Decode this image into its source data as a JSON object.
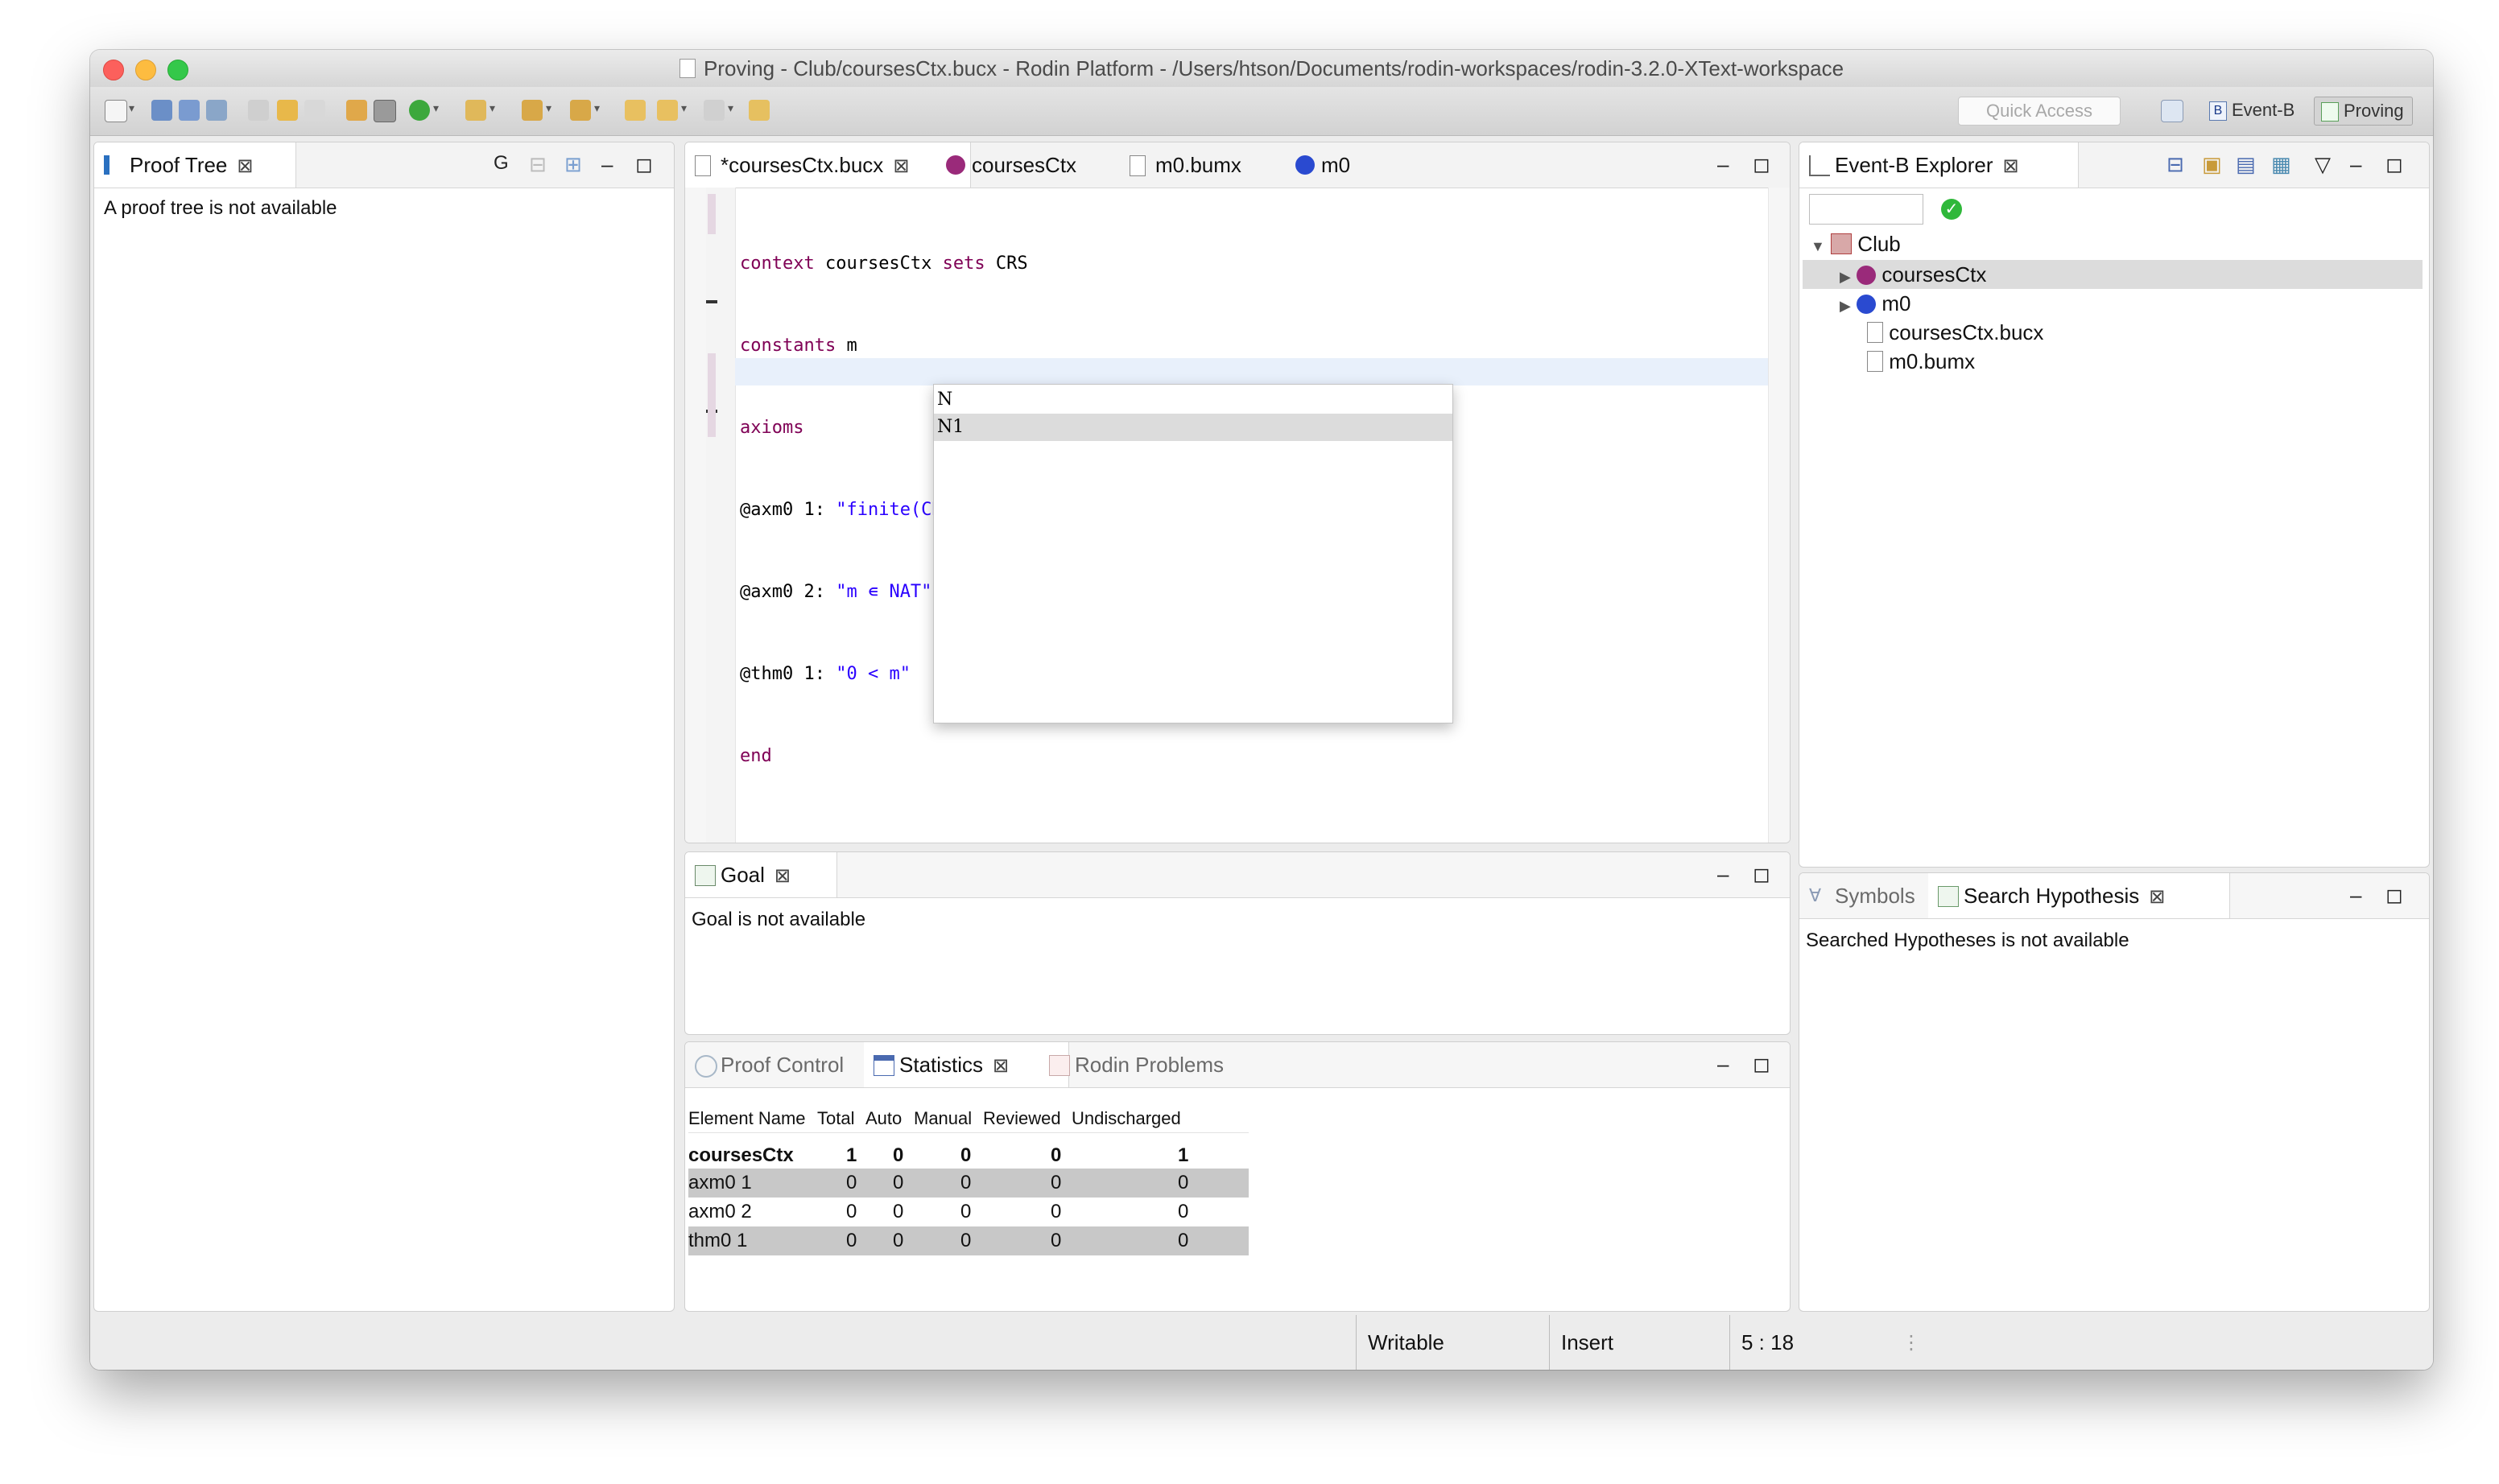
{
  "window": {
    "title": "Proving - Club/coursesCtx.bucx - Rodin Platform - /Users/htson/Documents/rodin-workspaces/rodin-3.2.0-XText-workspace"
  },
  "toolbar": {
    "quick_access_placeholder": "Quick Access",
    "perspectives": [
      "Event-B",
      "Proving"
    ]
  },
  "proof_tree": {
    "tab_label": "Proof Tree",
    "g_label": "G",
    "message": "A proof tree is not available"
  },
  "editor": {
    "tabs": [
      "*coursesCtx.bucx",
      "coursesCtx",
      "m0.bumx",
      "m0"
    ],
    "lines": [
      {
        "kw": "context",
        "rest": " coursesCtx ",
        "kw2": "sets",
        "rest2": " CRS"
      },
      {
        "kw": "constants",
        "rest": " m"
      },
      {
        "kw": "axioms",
        "rest": ""
      },
      {
        "label": "@axm0 1: ",
        "str": "\"finite(CRS)\""
      },
      {
        "label": "@axm0 2: ",
        "str": "\"m ∊ NAT\""
      },
      {
        "label": "@thm0 1: ",
        "str": "\"0 < m\""
      },
      {
        "kw": "end",
        "rest": ""
      }
    ],
    "completion": [
      "N",
      "N1"
    ]
  },
  "goal": {
    "tab_label": "Goal",
    "message": "Goal is not available"
  },
  "bottom_tabs": [
    "Proof Control",
    "Statistics",
    "Rodin Problems"
  ],
  "statistics": {
    "headers": [
      "Element Name",
      "Total",
      "Auto",
      "Manual",
      "Reviewed",
      "Undischarged"
    ],
    "rows": [
      [
        "coursesCtx",
        "1",
        "0",
        "0",
        "0",
        "1"
      ],
      [
        "axm0 1",
        "0",
        "0",
        "0",
        "0",
        "0"
      ],
      [
        "axm0 2",
        "0",
        "0",
        "0",
        "0",
        "0"
      ],
      [
        "thm0 1",
        "0",
        "0",
        "0",
        "0",
        "0"
      ]
    ]
  },
  "explorer": {
    "tab_label": "Event-B Explorer",
    "tree": [
      "Club",
      "coursesCtx",
      "m0",
      "coursesCtx.bucx",
      "m0.bumx"
    ]
  },
  "right_bottom": {
    "tabs": [
      "Symbols",
      "Search Hypothesis"
    ],
    "message": "Searched Hypotheses is not available"
  },
  "status": {
    "writable": "Writable",
    "mode": "Insert",
    "position": "5 : 18"
  },
  "colors": {
    "accent": "#2a00ff",
    "keyword": "#7f0055",
    "close_red": "#fc605c",
    "minimize_yellow": "#fdbc40",
    "maximize_green": "#34c84a"
  }
}
